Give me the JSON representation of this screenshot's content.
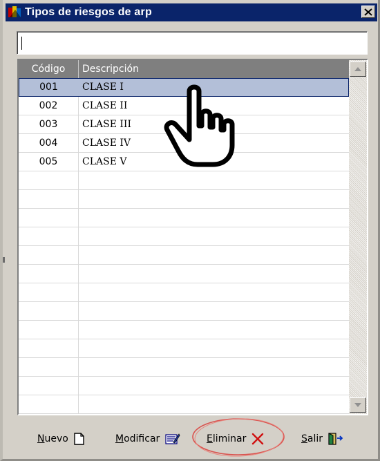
{
  "window": {
    "title": "Tipos de riesgos de arp",
    "close_label": "×"
  },
  "search": {
    "value": "",
    "placeholder": ""
  },
  "table": {
    "columns": [
      "Código",
      "Descripción"
    ],
    "rows": [
      {
        "codigo": "001",
        "descripcion": "CLASE I"
      },
      {
        "codigo": "002",
        "descripcion": "CLASE II"
      },
      {
        "codigo": "003",
        "descripcion": "CLASE III"
      },
      {
        "codigo": "004",
        "descripcion": "CLASE IV"
      },
      {
        "codigo": "005",
        "descripcion": "CLASE V"
      }
    ],
    "selected_index": 0
  },
  "footer": {
    "nuevo": "Nuevo",
    "modificar": "Modificar",
    "eliminar": "Eliminar",
    "salir": "Salir"
  },
  "colors": {
    "titlebar": "#0a246a",
    "header": "#7f7f7f",
    "selected_row": "#b3bfd8",
    "annotation_oval": "#d9534f"
  },
  "icons": [
    "app-icon",
    "close-icon",
    "scroll-up-icon",
    "scroll-down-icon",
    "new-document-icon",
    "edit-icon",
    "delete-icon",
    "exit-door-icon",
    "pointer-hand-icon"
  ]
}
